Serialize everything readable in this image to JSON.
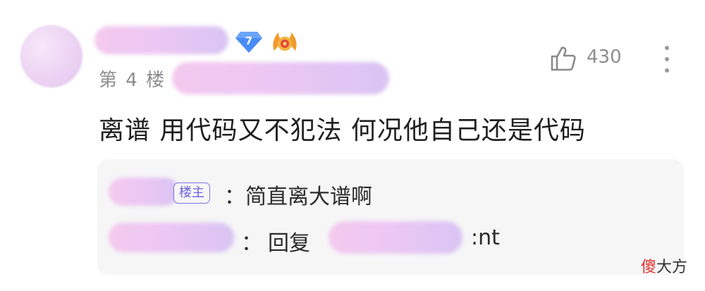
{
  "post": {
    "level_badge": "7",
    "floor_label": "第 4 楼",
    "likes": "430",
    "content": "离谱 用代码又不犯法 何况他自己还是代码"
  },
  "replies": [
    {
      "tag": "楼主",
      "colon": "：",
      "text": "简直离大谱啊"
    },
    {
      "colon": "：",
      "prefix": "回复",
      "text": ":nt"
    }
  ],
  "watermark": {
    "first_char": "傻",
    "rest": "大方"
  },
  "icons": {
    "level": "diamond-badge-icon",
    "honor": "flame-medal-icon",
    "like": "thumbs-up-icon",
    "more": "more-vertical-icon"
  },
  "colors": {
    "accent": "#6a60df",
    "badge": "#4a8cf7",
    "muted_text": "#8e8e8e",
    "watermark_red": "#e0322d"
  }
}
